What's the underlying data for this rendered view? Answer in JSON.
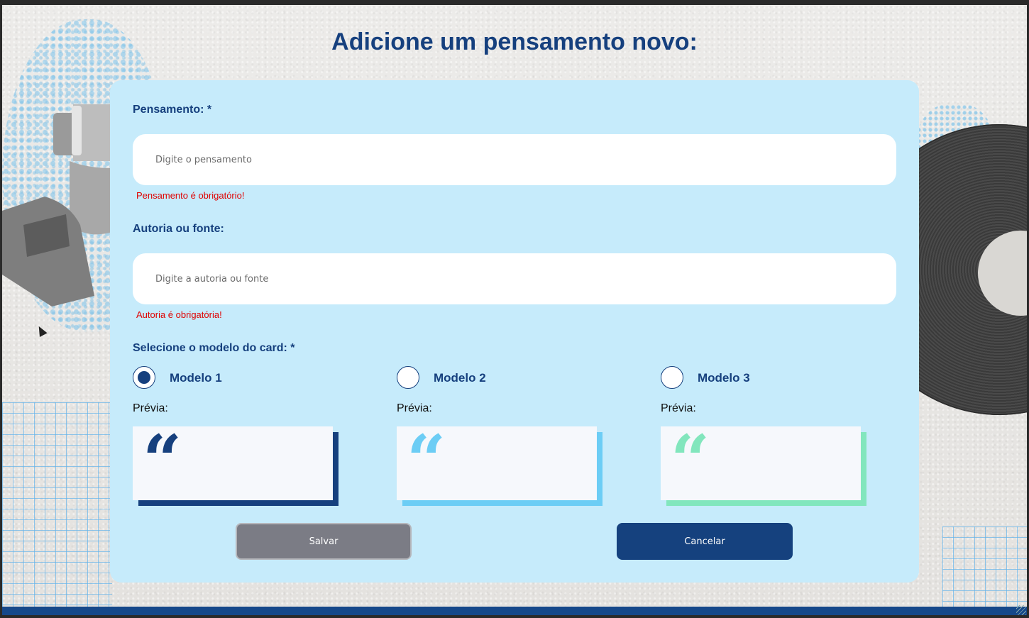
{
  "page": {
    "title": "Adicione um pensamento novo:"
  },
  "form": {
    "thought": {
      "label": "Pensamento: *",
      "placeholder": "Digite o pensamento",
      "value": "",
      "error": "Pensamento é obrigatório!"
    },
    "author": {
      "label": "Autoria ou fonte:",
      "placeholder": "Digite a autoria ou fonte",
      "value": "",
      "error": "Autoria é obrigatória!"
    },
    "model": {
      "label": "Selecione o modelo do card: *",
      "selected": "Modelo 1",
      "options": [
        {
          "label": "Modelo 1",
          "preview_label": "Prévia:",
          "checked": true,
          "color": "#16407e"
        },
        {
          "label": "Modelo 2",
          "preview_label": "Prévia:",
          "checked": false,
          "color": "#6ccdf5"
        },
        {
          "label": "Modelo 3",
          "preview_label": "Prévia:",
          "checked": false,
          "color": "#82e6bd"
        }
      ]
    },
    "buttons": {
      "save": "Salvar",
      "cancel": "Cancelar"
    }
  },
  "colors": {
    "primary": "#16407e",
    "card_background": "#c6ebfb",
    "error": "#e00000",
    "save_button": "#7b7c85",
    "cancel_button": "#15417e"
  },
  "icons": {
    "quote": "left-double-quote-icon"
  }
}
